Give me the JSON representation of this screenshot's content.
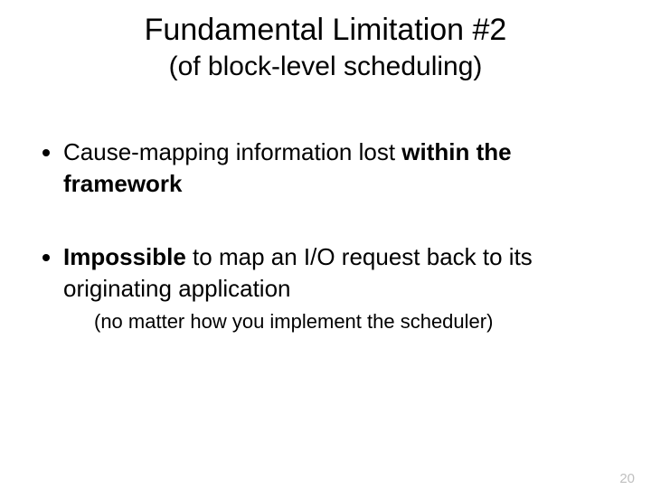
{
  "title": "Fundamental Limitation #2",
  "subtitle": "(of block-level scheduling)",
  "bullets": [
    {
      "pre": "Cause-mapping information lost ",
      "bold": "within the framework",
      "post": ""
    },
    {
      "pre": "",
      "bold": "Impossible",
      "post": " to map an I/O request back to its originating application"
    }
  ],
  "note": "(no matter how you implement the scheduler)",
  "page_number": "20"
}
